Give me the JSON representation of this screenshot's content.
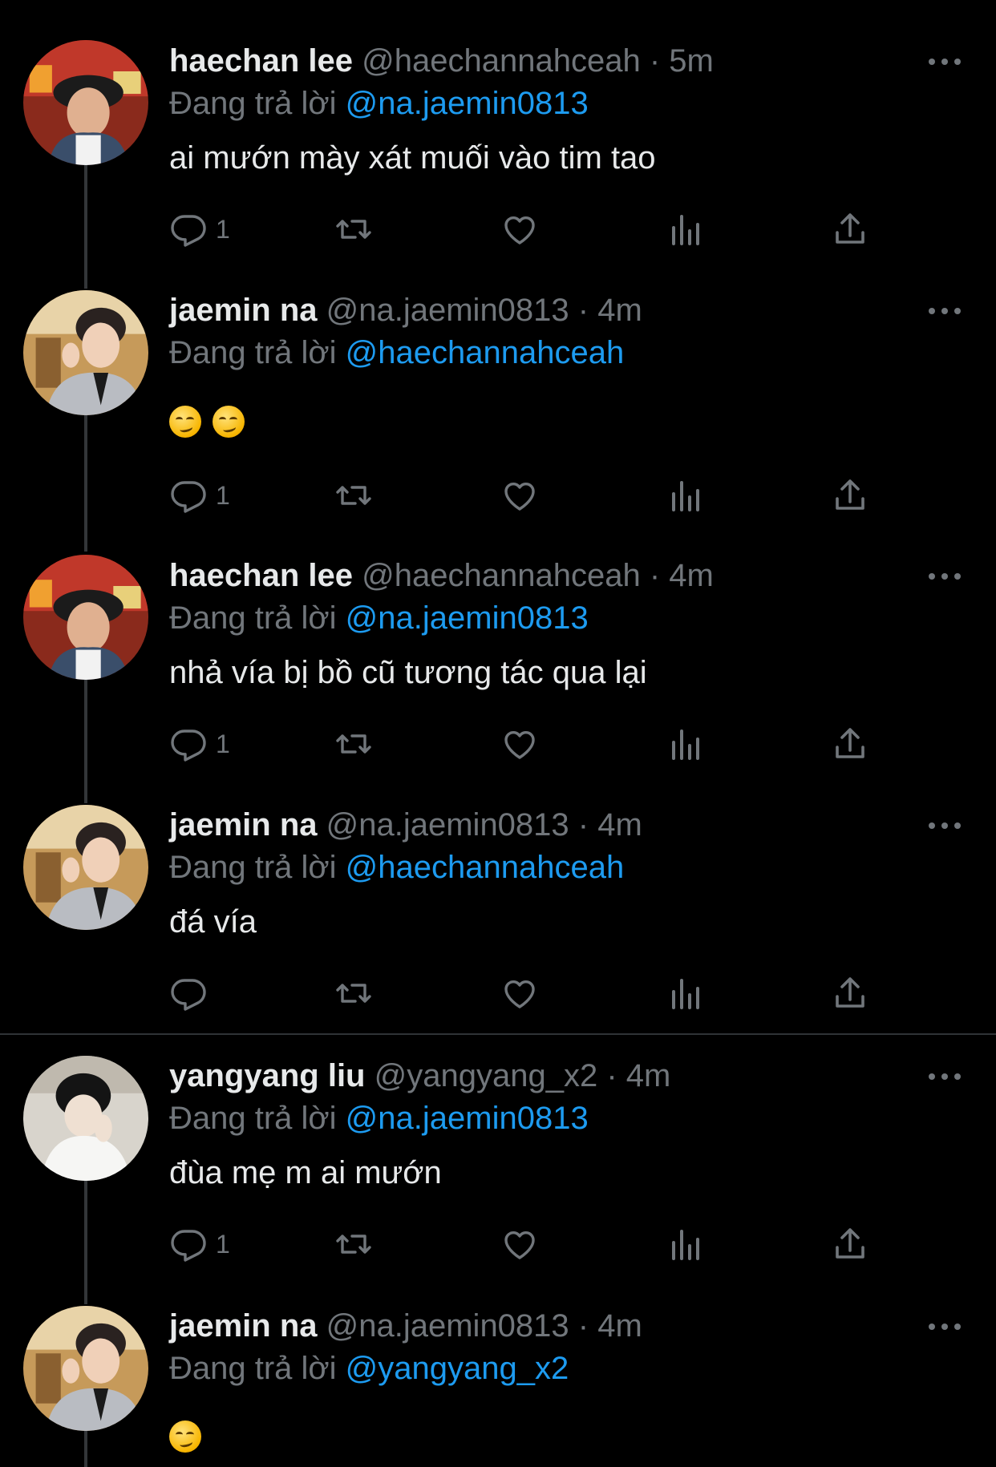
{
  "colors": {
    "background": "#000000",
    "text": "#e7e9ea",
    "muted": "#71767b",
    "accent": "#1d9bf0"
  },
  "icons": {
    "reply": "reply-icon",
    "retweet": "retweet-icon",
    "like": "heart-icon",
    "views": "views-icon",
    "share": "share-icon",
    "more": "more-icon",
    "emoji": "smirking-face-emoji"
  },
  "tweets": [
    {
      "name": "haechan lee",
      "handle": "@haechannahceah",
      "sep": "·",
      "time": "5m",
      "replying_label": "Đang trả lời",
      "replying_to": "@na.jaemin0813",
      "text": "ai mướn mày xát muối vào tim tao",
      "reply_count": "1"
    },
    {
      "name": "jaemin na",
      "handle": "@na.jaemin0813",
      "sep": "·",
      "time": "4m",
      "replying_label": "Đang trả lời",
      "replying_to": "@haechannahceah",
      "text": "",
      "reply_count": "1"
    },
    {
      "name": "haechan lee",
      "handle": "@haechannahceah",
      "sep": "·",
      "time": "4m",
      "replying_label": "Đang trả lời",
      "replying_to": "@na.jaemin0813",
      "text": "nhả vía bị bồ cũ tương tác qua lại",
      "reply_count": "1"
    },
    {
      "name": "jaemin na",
      "handle": "@na.jaemin0813",
      "sep": "·",
      "time": "4m",
      "replying_label": "Đang trả lời",
      "replying_to": "@haechannahceah",
      "text": "đá vía",
      "reply_count": ""
    },
    {
      "name": "yangyang liu",
      "handle": "@yangyang_x2",
      "sep": "·",
      "time": "4m",
      "replying_label": "Đang trả lời",
      "replying_to": "@na.jaemin0813",
      "text": "đùa mẹ m ai mướn",
      "reply_count": "1"
    },
    {
      "name": "jaemin na",
      "handle": "@na.jaemin0813",
      "sep": "·",
      "time": "4m",
      "replying_label": "Đang trả lời",
      "replying_to": "@yangyang_x2",
      "text": "",
      "reply_count": ""
    }
  ]
}
